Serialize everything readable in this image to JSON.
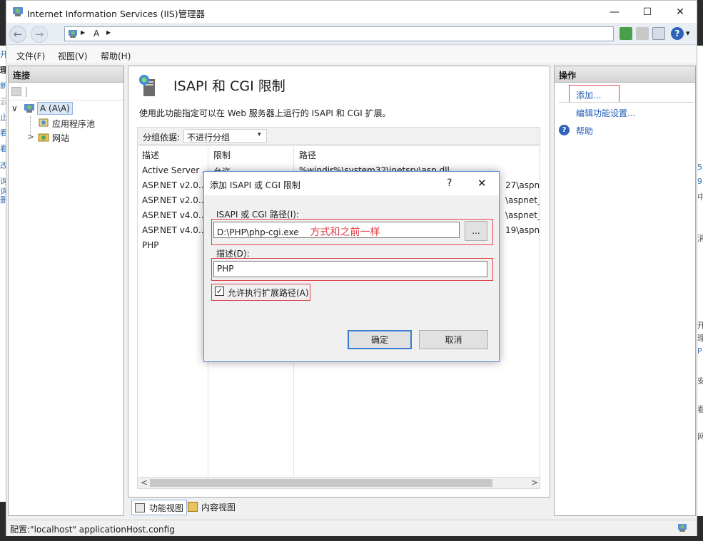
{
  "window": {
    "title": "Internet Information Services (IIS)管理器",
    "min_icon": "—",
    "max_icon": "☐",
    "close_icon": "✕"
  },
  "nav": {
    "back_icon": "←",
    "forward_icon": "→",
    "address_sep": "▶",
    "address_node": "A",
    "help_icon": "?",
    "dropdown_icon": "▾"
  },
  "menu": [
    "文件(F)",
    "视图(V)",
    "帮助(H)"
  ],
  "connections": {
    "header": "连接",
    "tree": {
      "root": "A (A\\A)",
      "expander": "∨",
      "children": [
        {
          "label": "应用程序池",
          "expander": ""
        },
        {
          "label": "网站",
          "expander": ">"
        }
      ]
    }
  },
  "feature": {
    "title": "ISAPI 和 CGI 限制",
    "description": "使用此功能指定可以在 Web 服务器上运行的 ISAPI 和 CGI 扩展。",
    "group_label": "分组依据:",
    "group_value": "不进行分组",
    "sort_icon": "^",
    "columns": [
      "描述",
      "限制",
      "路径"
    ],
    "rows": [
      {
        "desc": "Active Server ...",
        "restriction": "允许",
        "path": "%windir%\\system32\\inetsrv\\asp.dll"
      },
      {
        "desc": "ASP.NET v2.0....",
        "restriction": "",
        "path": "27\\aspnet"
      },
      {
        "desc": "ASP.NET v2.0....",
        "restriction": "",
        "path": "\\aspnet_is"
      },
      {
        "desc": "ASP.NET v4.0....",
        "restriction": "",
        "path": "\\aspnet_is"
      },
      {
        "desc": "ASP.NET v4.0....",
        "restriction": "",
        "path": "19\\aspnet"
      },
      {
        "desc": "PHP",
        "restriction": "",
        "path": ""
      }
    ],
    "scroll_left": "<",
    "scroll_right": ">"
  },
  "view_tabs": [
    "功能视图",
    "内容视图"
  ],
  "actions": {
    "header": "操作",
    "items": [
      "添加...",
      "编辑功能设置...",
      "帮助"
    ]
  },
  "status": {
    "text": "配置:\"localhost\" applicationHost.config"
  },
  "dialog": {
    "title": "添加 ISAPI 或 CGI 限制",
    "help_icon": "?",
    "close_icon": "✕",
    "path_label": "ISAPI 或 CGI 路径(I):",
    "path_value": "D:\\PHP\\php-cgi.exe",
    "annotation": "方式和之前一样",
    "browse_label": "...",
    "desc_label": "描述(D):",
    "desc_value": "PHP",
    "checkbox_label": "允许执行扩展路径(A)",
    "checkbox_mark": "✓",
    "ok": "确定",
    "cancel": "取消"
  },
  "background": {
    "left_chars": [
      "开",
      "理",
      "新",
      "云",
      "止",
      "看",
      "看",
      "改",
      "询",
      "询",
      "删"
    ],
    "right_chars": [
      "5",
      "9",
      "中",
      "消",
      "开",
      "理",
      "P",
      "安",
      "看",
      "网"
    ]
  },
  "colors": {
    "link": "#1f5db8",
    "annotation_red": "#e0404a",
    "dialog_border": "#5b8fd4"
  }
}
